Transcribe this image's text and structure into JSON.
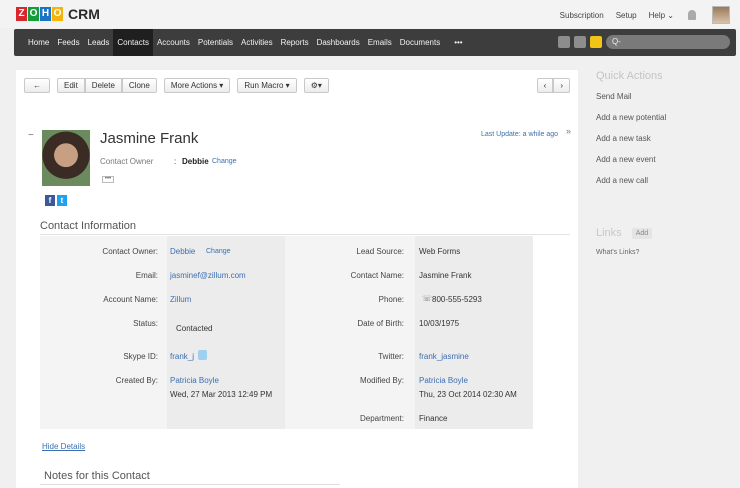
{
  "brand": {
    "logo_letters": [
      "Z",
      "O",
      "H",
      "O"
    ],
    "logo_colors": [
      "#d8262c",
      "#159c3b",
      "#1a74c8",
      "#f5b40b"
    ],
    "product": "CRM"
  },
  "header": {
    "subscription": "Subscription",
    "setup": "Setup",
    "help": "Help ⌄"
  },
  "nav": {
    "items": [
      "Home",
      "Feeds",
      "Leads",
      "Contacts",
      "Accounts",
      "Potentials",
      "Activities",
      "Reports",
      "Dashboards",
      "Emails",
      "Documents",
      "•••"
    ],
    "active_index": 3,
    "search_placeholder": "Q-"
  },
  "toolbar": {
    "back": "←",
    "edit": "Edit",
    "delete": "Delete",
    "clone": "Clone",
    "more_actions": "More Actions ▾",
    "run_macro": "Run Macro ▾",
    "settings": "⚙▾",
    "prev": "‹",
    "next": "›"
  },
  "contact": {
    "collapse": "−",
    "name": "Jasmine Frank",
    "owner_label": "Contact Owner",
    "owner_colon": ":",
    "owner_value": "Debbie",
    "owner_change": "Change",
    "more": "•••",
    "last_update": "Last Update: a while ago",
    "expand": "»"
  },
  "section": {
    "title": "Contact Information",
    "hide_details": "Hide Details",
    "notes_title": "Notes for this Contact"
  },
  "fields": {
    "contact_owner": {
      "label": "Contact Owner:",
      "value": "Debbie",
      "extra": "Change"
    },
    "email": {
      "label": "Email:",
      "value": "jasminef@zillum.com"
    },
    "account_name": {
      "label": "Account Name:",
      "value": "Zillum"
    },
    "status": {
      "label": "Status:",
      "value": "Contacted"
    },
    "skype": {
      "label": "Skype ID:",
      "value": "frank_j"
    },
    "created_by": {
      "label": "Created By:",
      "value": "Patricia Boyle",
      "date": "Wed, 27 Mar 2013 12:49 PM"
    },
    "lead_source": {
      "label": "Lead Source:",
      "value": "Web Forms"
    },
    "contact_name": {
      "label": "Contact Name:",
      "value": "Jasmine Frank"
    },
    "phone": {
      "label": "Phone:",
      "value": "800-555-5293",
      "icon": "☏"
    },
    "dob": {
      "label": "Date of Birth:",
      "value": "10/03/1975"
    },
    "twitter": {
      "label": "Twitter:",
      "value": "frank_jasmine"
    },
    "modified_by": {
      "label": "Modified By:",
      "value": "Patricia Boyle",
      "date": "Thu, 23 Oct 2014 02:30 AM"
    },
    "department": {
      "label": "Department:",
      "value": "Finance"
    }
  },
  "quick_actions": {
    "title": "Quick Actions",
    "items": [
      "Send Mail",
      "Add a new potential",
      "Add a new task",
      "Add a new event",
      "Add a new call"
    ]
  },
  "links": {
    "title": "Links",
    "add": "Add",
    "whats": "What's Links?"
  },
  "social": {
    "facebook": "f",
    "twitter": "t"
  },
  "colors": {
    "nav_bg": "#3d3d3d",
    "link": "#3c6fb0",
    "facebook": "#3b5998",
    "twitter": "#1da1f2"
  }
}
